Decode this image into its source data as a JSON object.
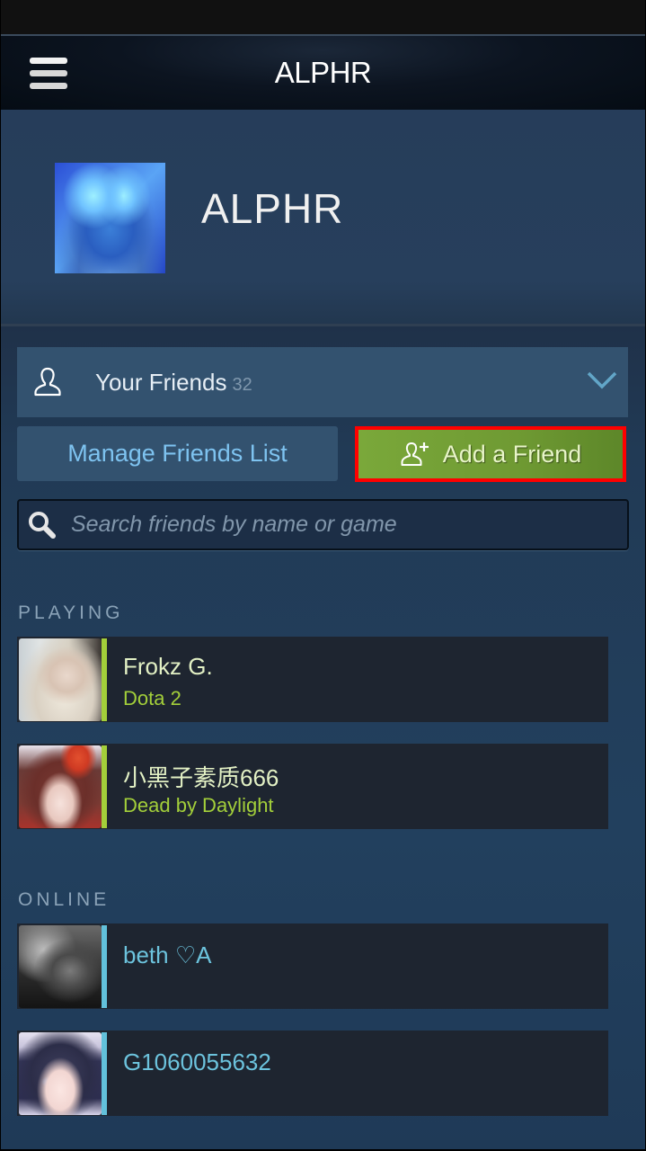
{
  "app": {
    "nav_title": "ALPHR",
    "menu_icon": "hamburger-menu-icon"
  },
  "profile": {
    "username": "ALPHR",
    "avatar": "gas-mask-avatar"
  },
  "friends_panel": {
    "label": "Your Friends",
    "count": "32",
    "icon": "user-icon",
    "expand_icon": "chevron-down-icon"
  },
  "actions": {
    "manage_label": "Manage Friends List",
    "add_label": "Add a Friend",
    "add_icon": "add-user-icon",
    "highlight_color": "#ff0000"
  },
  "search": {
    "placeholder": "Search friends by name or game",
    "value": "",
    "icon": "search-icon"
  },
  "sections": {
    "playing": {
      "title": "PLAYING",
      "friends": [
        {
          "name": "Frokz G.",
          "game": "Dota 2"
        },
        {
          "name": "小黑子素质666",
          "game": "Dead by Daylight"
        }
      ]
    },
    "online": {
      "title": "ONLINE",
      "friends": [
        {
          "name": "beth ♡A"
        },
        {
          "name": "G1060055632"
        }
      ]
    }
  },
  "colors": {
    "playing_accent": "#a3cf3a",
    "online_accent": "#62c1db",
    "add_button_green": "#75a236",
    "manage_text_blue": "#7ec3f0"
  }
}
